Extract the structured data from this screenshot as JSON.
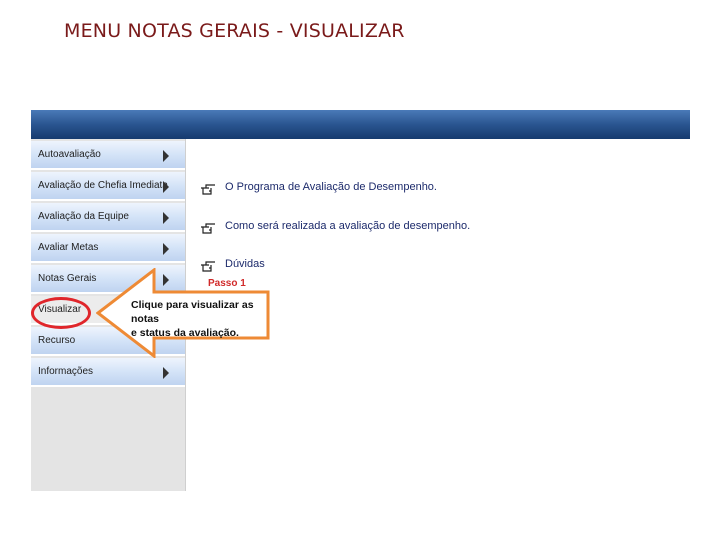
{
  "slide_title": "MENU NOTAS GERAIS - VISUALIZAR",
  "sidebar": {
    "items": [
      {
        "label": "Autoavaliação",
        "has_arrow": true
      },
      {
        "label": "Avaliação de Chefia Imediata",
        "has_arrow": true
      },
      {
        "label": "Avaliação da Equipe",
        "has_arrow": true
      },
      {
        "label": "Avaliar Metas",
        "has_arrow": true
      },
      {
        "label": "Notas Gerais",
        "has_arrow": true
      },
      {
        "label": "Visualizar",
        "has_arrow": false
      },
      {
        "label": "Recurso",
        "has_arrow": false
      },
      {
        "label": "Informações",
        "has_arrow": true
      }
    ]
  },
  "main": {
    "links": [
      {
        "label": "O Programa de Avaliação de Desempenho.",
        "icon": "pointing-hand-icon"
      },
      {
        "label": "Como será realizada a avaliação de desempenho.",
        "icon": "pointing-hand-icon"
      },
      {
        "label": "Dúvidas",
        "icon": "pointing-hand-icon"
      }
    ]
  },
  "annotation": {
    "step": "Passo 1",
    "text_line1": "Clique para visualizar as notas",
    "text_line2": "e status da avaliação.",
    "highlight_color": "#e0262b",
    "arrow_color": "#ee8a35"
  },
  "colors": {
    "title": "#7a1a1a",
    "topbar": "#2a5590",
    "link_text": "#1c2a6b"
  }
}
